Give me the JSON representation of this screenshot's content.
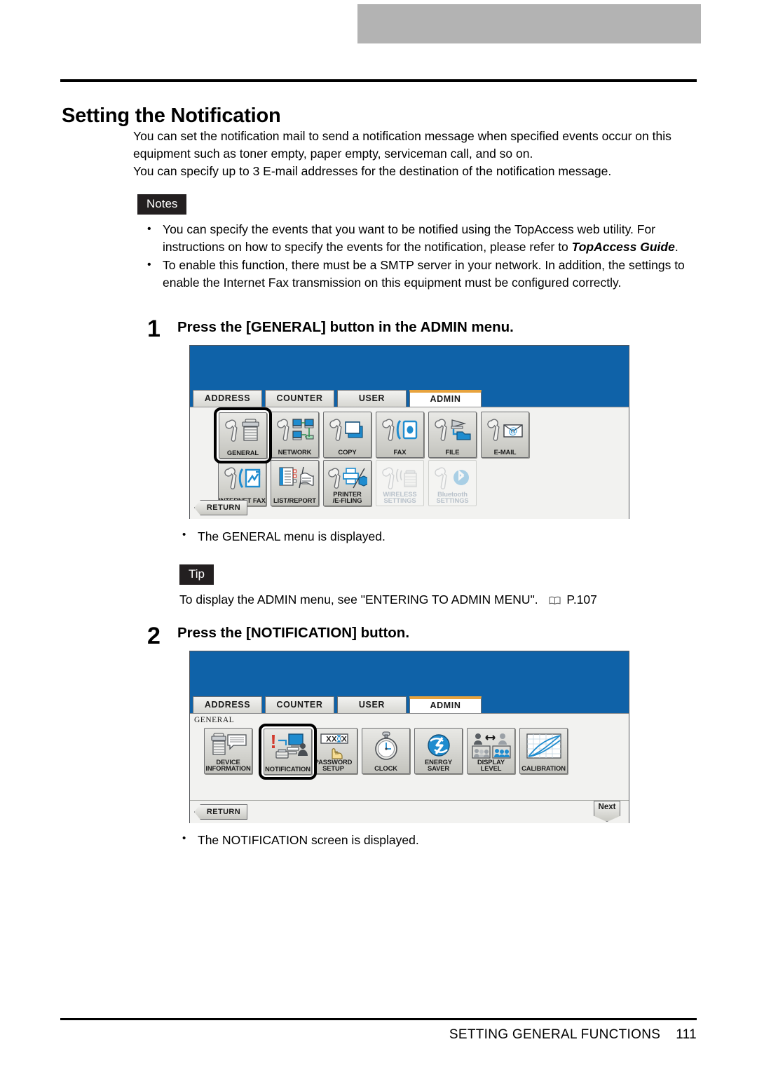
{
  "document": {
    "title": "Setting the Notification",
    "intro_paragraphs": [
      "You can set the notification mail to send a notification message when specified events occur on this equipment such as toner empty, paper empty, serviceman call, and so on.",
      "You can specify up to 3 E-mail addresses for the destination of the notification message."
    ]
  },
  "notes": {
    "badge": "Notes",
    "items": [
      {
        "text_before": "You can specify the events that you want to be notified using the TopAccess web utility.  For instructions on how to specify the events for the notification, please refer to ",
        "emphasis": "TopAccess Guide",
        "text_after": "."
      },
      {
        "text_before": "To enable this function, there must be a SMTP server in your network.  In addition, the settings to enable the Internet Fax transmission on this equipment must be configured correctly.",
        "emphasis": "",
        "text_after": ""
      }
    ]
  },
  "steps": [
    {
      "number": "1",
      "heading": "Press the [GENERAL] button in the ADMIN menu.",
      "result": "The GENERAL menu is displayed."
    },
    {
      "number": "2",
      "heading": "Press the [NOTIFICATION] button.",
      "result": "The NOTIFICATION screen is displayed."
    }
  ],
  "tip": {
    "badge": "Tip",
    "text_before": "To display the ADMIN menu, see \"ENTERING TO ADMIN MENU\".",
    "icon": "book-icon",
    "reference": "P.107"
  },
  "panel_admin": {
    "tabs": [
      {
        "label": "ADDRESS",
        "active": false
      },
      {
        "label": "COUNTER",
        "active": false
      },
      {
        "label": "USER",
        "active": false
      },
      {
        "label": "ADMIN",
        "active": true
      }
    ],
    "breadcrumb": "",
    "row1": [
      {
        "label": "GENERAL",
        "icon": "wrench-printer-icon",
        "disabled": false,
        "selected": true
      },
      {
        "label": "NETWORK",
        "icon": "wrench-network-icon",
        "disabled": false,
        "selected": false
      },
      {
        "label": "COPY",
        "icon": "wrench-copy-icon",
        "disabled": false,
        "selected": false
      },
      {
        "label": "FAX",
        "icon": "wrench-fax-icon",
        "disabled": false,
        "selected": false
      },
      {
        "label": "FILE",
        "icon": "wrench-file-icon",
        "disabled": false,
        "selected": false
      },
      {
        "label": "E-MAIL",
        "icon": "wrench-email-icon",
        "disabled": false,
        "selected": false
      }
    ],
    "row2": [
      {
        "label": "INTERNET FAX",
        "icon": "wrench-internet-fax-icon",
        "disabled": false,
        "selected": false
      },
      {
        "label": "LIST/REPORT",
        "icon": "list-report-icon",
        "disabled": false,
        "selected": false
      },
      {
        "label": "PRINTER\n/E-FILING",
        "icon": "wrench-printer-efiling-icon",
        "disabled": false,
        "selected": false
      },
      {
        "label": "WIRELESS\nSETTINGS",
        "icon": "wrench-wireless-icon",
        "disabled": true,
        "selected": false
      },
      {
        "label": "Bluetooth\nSETTINGS",
        "icon": "wrench-bluetooth-icon",
        "disabled": true,
        "selected": false
      }
    ],
    "return_label": "RETURN"
  },
  "panel_general": {
    "tabs": [
      {
        "label": "ADDRESS",
        "active": false
      },
      {
        "label": "COUNTER",
        "active": false
      },
      {
        "label": "USER",
        "active": false
      },
      {
        "label": "ADMIN",
        "active": true
      }
    ],
    "breadcrumb": "GENERAL",
    "row1": [
      {
        "label": "DEVICE\nINFORMATION",
        "icon": "device-information-icon",
        "disabled": false,
        "selected": false
      },
      {
        "label": "NOTIFICATION",
        "icon": "notification-icon",
        "disabled": false,
        "selected": true
      },
      {
        "label": "PASSWORD SETUP",
        "icon": "password-setup-icon",
        "disabled": false,
        "selected": false
      },
      {
        "label": "CLOCK",
        "icon": "clock-icon",
        "disabled": false,
        "selected": false
      },
      {
        "label": "ENERGY\nSAVER",
        "icon": "energy-saver-icon",
        "disabled": false,
        "selected": false
      },
      {
        "label": "DISPLAY LEVEL",
        "icon": "display-level-icon",
        "disabled": false,
        "selected": false
      },
      {
        "label": "CALIBRATION",
        "icon": "calibration-icon",
        "disabled": false,
        "selected": false
      }
    ],
    "return_label": "RETURN",
    "next_label": "Next",
    "password_icon_text": "XXXXX"
  },
  "footer": {
    "chapter": "SETTING GENERAL FUNCTIONS",
    "page_number": "111"
  },
  "colors": {
    "panel_blue": "#0f62a8",
    "active_tab_accent": "#e8a33d",
    "badge_bg": "#231f20",
    "icon_blue": "#1f8ccf",
    "top_band": "#b3b3b3"
  }
}
